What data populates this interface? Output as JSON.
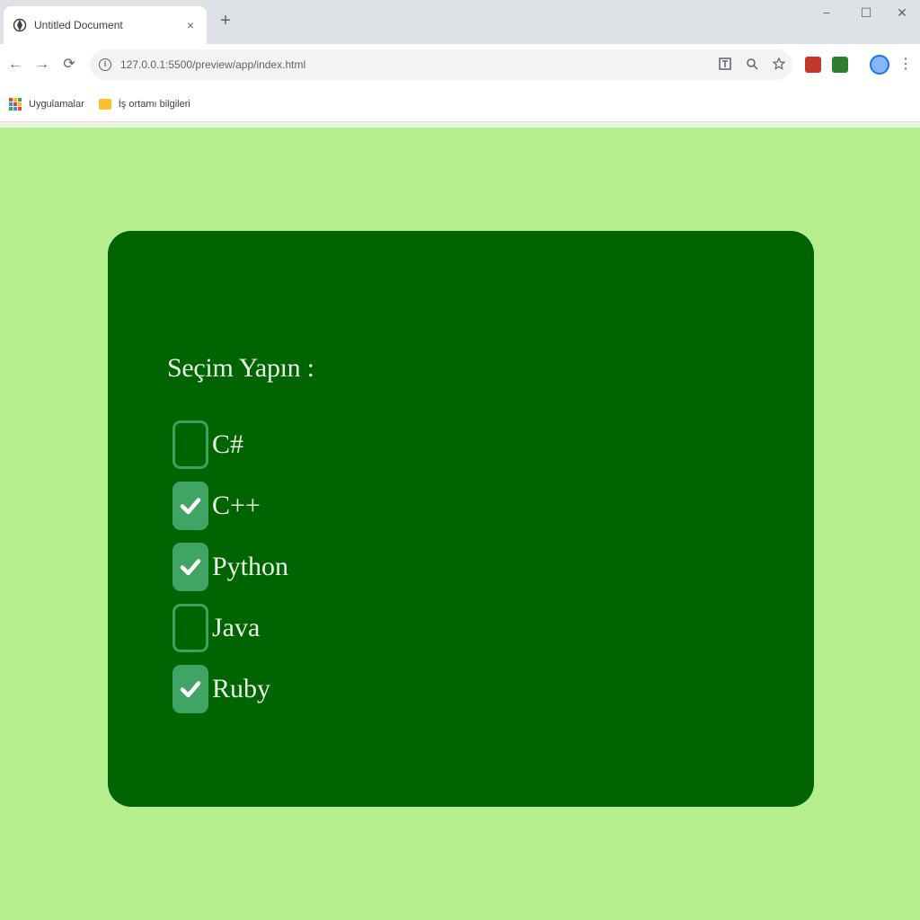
{
  "browser": {
    "tab_title": "Untitled Document",
    "tab_close": "×",
    "new_tab": "+",
    "window_controls": {
      "minimize": "−",
      "maximize": "☐",
      "close": "✕"
    },
    "nav": {
      "back": "←",
      "forward": "→",
      "reload": "⟳"
    },
    "url": "127.0.0.1:5500/preview/app/index.html",
    "bookmarks": [
      {
        "label": "Uygulamalar",
        "icon": "apps-grid-icon"
      },
      {
        "label": "İş ortamı bilgileri",
        "icon": "folder-icon"
      }
    ]
  },
  "form": {
    "heading": "Seçim Yapın :",
    "options": [
      {
        "label": "C#",
        "checked": false
      },
      {
        "label": "C++",
        "checked": true
      },
      {
        "label": "Python",
        "checked": true
      },
      {
        "label": "Java",
        "checked": false
      },
      {
        "label": "Ruby",
        "checked": true
      }
    ]
  },
  "colors": {
    "page_background": "#b6ee8e",
    "card_background": "#006400",
    "checkbox_checked": "#40a464",
    "checkbox_border": "#3ca35f",
    "text": "#e8f5e8"
  }
}
